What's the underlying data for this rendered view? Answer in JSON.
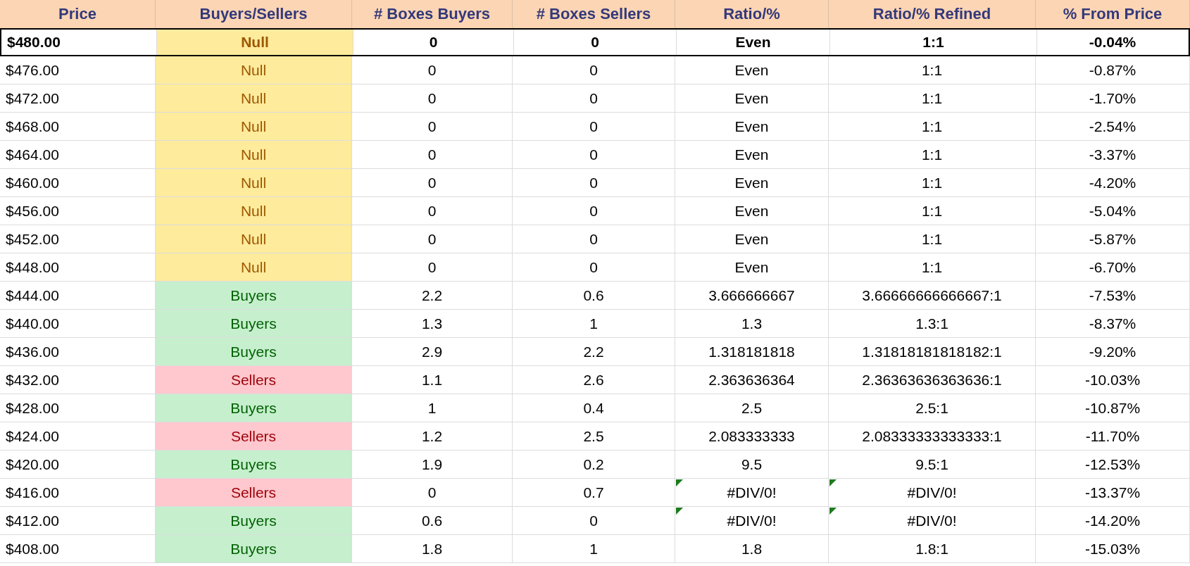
{
  "columns": [
    "Price",
    "Buyers/Sellers",
    "# Boxes Buyers",
    "# Boxes Sellers",
    "Ratio/%",
    "Ratio/% Refined",
    "% From Price"
  ],
  "rows": [
    {
      "price": "$480.00",
      "status": {
        "kind": "null",
        "label": "Null"
      },
      "boxes_buyers": "0",
      "boxes_sellers": "0",
      "ratio": "Even",
      "ratio_refined": "1:1",
      "from_price": "-0.04%",
      "highlighted": true,
      "ratio_error": false,
      "refined_error": false
    },
    {
      "price": "$476.00",
      "status": {
        "kind": "null",
        "label": "Null"
      },
      "boxes_buyers": "0",
      "boxes_sellers": "0",
      "ratio": "Even",
      "ratio_refined": "1:1",
      "from_price": "-0.87%",
      "highlighted": false,
      "ratio_error": false,
      "refined_error": false
    },
    {
      "price": "$472.00",
      "status": {
        "kind": "null",
        "label": "Null"
      },
      "boxes_buyers": "0",
      "boxes_sellers": "0",
      "ratio": "Even",
      "ratio_refined": "1:1",
      "from_price": "-1.70%",
      "highlighted": false,
      "ratio_error": false,
      "refined_error": false
    },
    {
      "price": "$468.00",
      "status": {
        "kind": "null",
        "label": "Null"
      },
      "boxes_buyers": "0",
      "boxes_sellers": "0",
      "ratio": "Even",
      "ratio_refined": "1:1",
      "from_price": "-2.54%",
      "highlighted": false,
      "ratio_error": false,
      "refined_error": false
    },
    {
      "price": "$464.00",
      "status": {
        "kind": "null",
        "label": "Null"
      },
      "boxes_buyers": "0",
      "boxes_sellers": "0",
      "ratio": "Even",
      "ratio_refined": "1:1",
      "from_price": "-3.37%",
      "highlighted": false,
      "ratio_error": false,
      "refined_error": false
    },
    {
      "price": "$460.00",
      "status": {
        "kind": "null",
        "label": "Null"
      },
      "boxes_buyers": "0",
      "boxes_sellers": "0",
      "ratio": "Even",
      "ratio_refined": "1:1",
      "from_price": "-4.20%",
      "highlighted": false,
      "ratio_error": false,
      "refined_error": false
    },
    {
      "price": "$456.00",
      "status": {
        "kind": "null",
        "label": "Null"
      },
      "boxes_buyers": "0",
      "boxes_sellers": "0",
      "ratio": "Even",
      "ratio_refined": "1:1",
      "from_price": "-5.04%",
      "highlighted": false,
      "ratio_error": false,
      "refined_error": false
    },
    {
      "price": "$452.00",
      "status": {
        "kind": "null",
        "label": "Null"
      },
      "boxes_buyers": "0",
      "boxes_sellers": "0",
      "ratio": "Even",
      "ratio_refined": "1:1",
      "from_price": "-5.87%",
      "highlighted": false,
      "ratio_error": false,
      "refined_error": false
    },
    {
      "price": "$448.00",
      "status": {
        "kind": "null",
        "label": "Null"
      },
      "boxes_buyers": "0",
      "boxes_sellers": "0",
      "ratio": "Even",
      "ratio_refined": "1:1",
      "from_price": "-6.70%",
      "highlighted": false,
      "ratio_error": false,
      "refined_error": false
    },
    {
      "price": "$444.00",
      "status": {
        "kind": "buyers",
        "label": "Buyers"
      },
      "boxes_buyers": "2.2",
      "boxes_sellers": "0.6",
      "ratio": "3.666666667",
      "ratio_refined": "3.66666666666667:1",
      "from_price": "-7.53%",
      "highlighted": false,
      "ratio_error": false,
      "refined_error": false
    },
    {
      "price": "$440.00",
      "status": {
        "kind": "buyers",
        "label": "Buyers"
      },
      "boxes_buyers": "1.3",
      "boxes_sellers": "1",
      "ratio": "1.3",
      "ratio_refined": "1.3:1",
      "from_price": "-8.37%",
      "highlighted": false,
      "ratio_error": false,
      "refined_error": false
    },
    {
      "price": "$436.00",
      "status": {
        "kind": "buyers",
        "label": "Buyers"
      },
      "boxes_buyers": "2.9",
      "boxes_sellers": "2.2",
      "ratio": "1.318181818",
      "ratio_refined": "1.31818181818182:1",
      "from_price": "-9.20%",
      "highlighted": false,
      "ratio_error": false,
      "refined_error": false
    },
    {
      "price": "$432.00",
      "status": {
        "kind": "sellers",
        "label": "Sellers"
      },
      "boxes_buyers": "1.1",
      "boxes_sellers": "2.6",
      "ratio": "2.363636364",
      "ratio_refined": "2.36363636363636:1",
      "from_price": "-10.03%",
      "highlighted": false,
      "ratio_error": false,
      "refined_error": false
    },
    {
      "price": "$428.00",
      "status": {
        "kind": "buyers",
        "label": "Buyers"
      },
      "boxes_buyers": "1",
      "boxes_sellers": "0.4",
      "ratio": "2.5",
      "ratio_refined": "2.5:1",
      "from_price": "-10.87%",
      "highlighted": false,
      "ratio_error": false,
      "refined_error": false
    },
    {
      "price": "$424.00",
      "status": {
        "kind": "sellers",
        "label": "Sellers"
      },
      "boxes_buyers": "1.2",
      "boxes_sellers": "2.5",
      "ratio": "2.083333333",
      "ratio_refined": "2.08333333333333:1",
      "from_price": "-11.70%",
      "highlighted": false,
      "ratio_error": false,
      "refined_error": false
    },
    {
      "price": "$420.00",
      "status": {
        "kind": "buyers",
        "label": "Buyers"
      },
      "boxes_buyers": "1.9",
      "boxes_sellers": "0.2",
      "ratio": "9.5",
      "ratio_refined": "9.5:1",
      "from_price": "-12.53%",
      "highlighted": false,
      "ratio_error": false,
      "refined_error": false
    },
    {
      "price": "$416.00",
      "status": {
        "kind": "sellers",
        "label": "Sellers"
      },
      "boxes_buyers": "0",
      "boxes_sellers": "0.7",
      "ratio": "#DIV/0!",
      "ratio_refined": "#DIV/0!",
      "from_price": "-13.37%",
      "highlighted": false,
      "ratio_error": true,
      "refined_error": true
    },
    {
      "price": "$412.00",
      "status": {
        "kind": "buyers",
        "label": "Buyers"
      },
      "boxes_buyers": "0.6",
      "boxes_sellers": "0",
      "ratio": "#DIV/0!",
      "ratio_refined": "#DIV/0!",
      "from_price": "-14.20%",
      "highlighted": false,
      "ratio_error": true,
      "refined_error": true
    },
    {
      "price": "$408.00",
      "status": {
        "kind": "buyers",
        "label": "Buyers"
      },
      "boxes_buyers": "1.8",
      "boxes_sellers": "1",
      "ratio": "1.8",
      "ratio_refined": "1.8:1",
      "from_price": "-15.03%",
      "highlighted": false,
      "ratio_error": false,
      "refined_error": false
    }
  ]
}
